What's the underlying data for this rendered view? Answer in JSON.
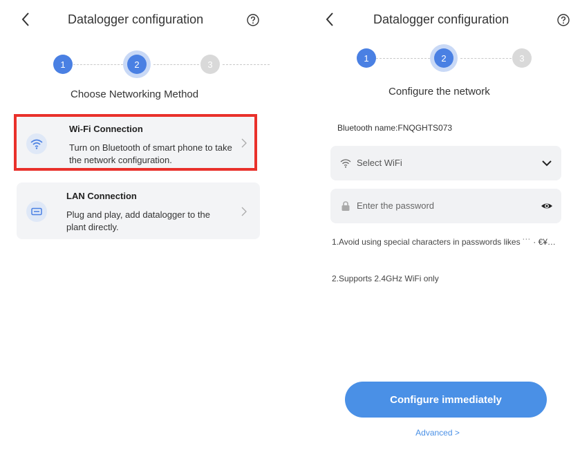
{
  "left": {
    "header": {
      "title": "Datalogger configuration"
    },
    "steps": [
      "1",
      "2",
      "3"
    ],
    "subtitle": "Choose Networking Method",
    "options": [
      {
        "title": "Wi-Fi Connection",
        "description": "Turn on Bluetooth of smart phone to take the network configuration.",
        "icon": "wifi-icon",
        "highlighted": true
      },
      {
        "title": "LAN Connection",
        "description": "Plug and play, add datalogger to the plant directly.",
        "icon": "lan-icon",
        "highlighted": false
      }
    ]
  },
  "right": {
    "header": {
      "title": "Datalogger configuration"
    },
    "steps": [
      "1",
      "2",
      "3"
    ],
    "subtitle": "Configure the network",
    "bluetooth_name": "Bluetooth name:FNQGHTS073",
    "wifi_select": {
      "value": "Select WiFi"
    },
    "password": {
      "placeholder": "Enter the password"
    },
    "notes": [
      "1.Avoid using special characters in passwords likes ˙˙˙ · €¥…",
      "2.Supports 2.4GHz WiFi only"
    ],
    "configure_button": "Configure immediately",
    "advanced_link": "Advanced  >"
  },
  "colors": {
    "accent": "#4a90e6",
    "step_active": "#4a80e3",
    "step_inactive": "#d9d9d9",
    "highlight": "#e9312b",
    "card_bg": "#f3f4f6"
  }
}
